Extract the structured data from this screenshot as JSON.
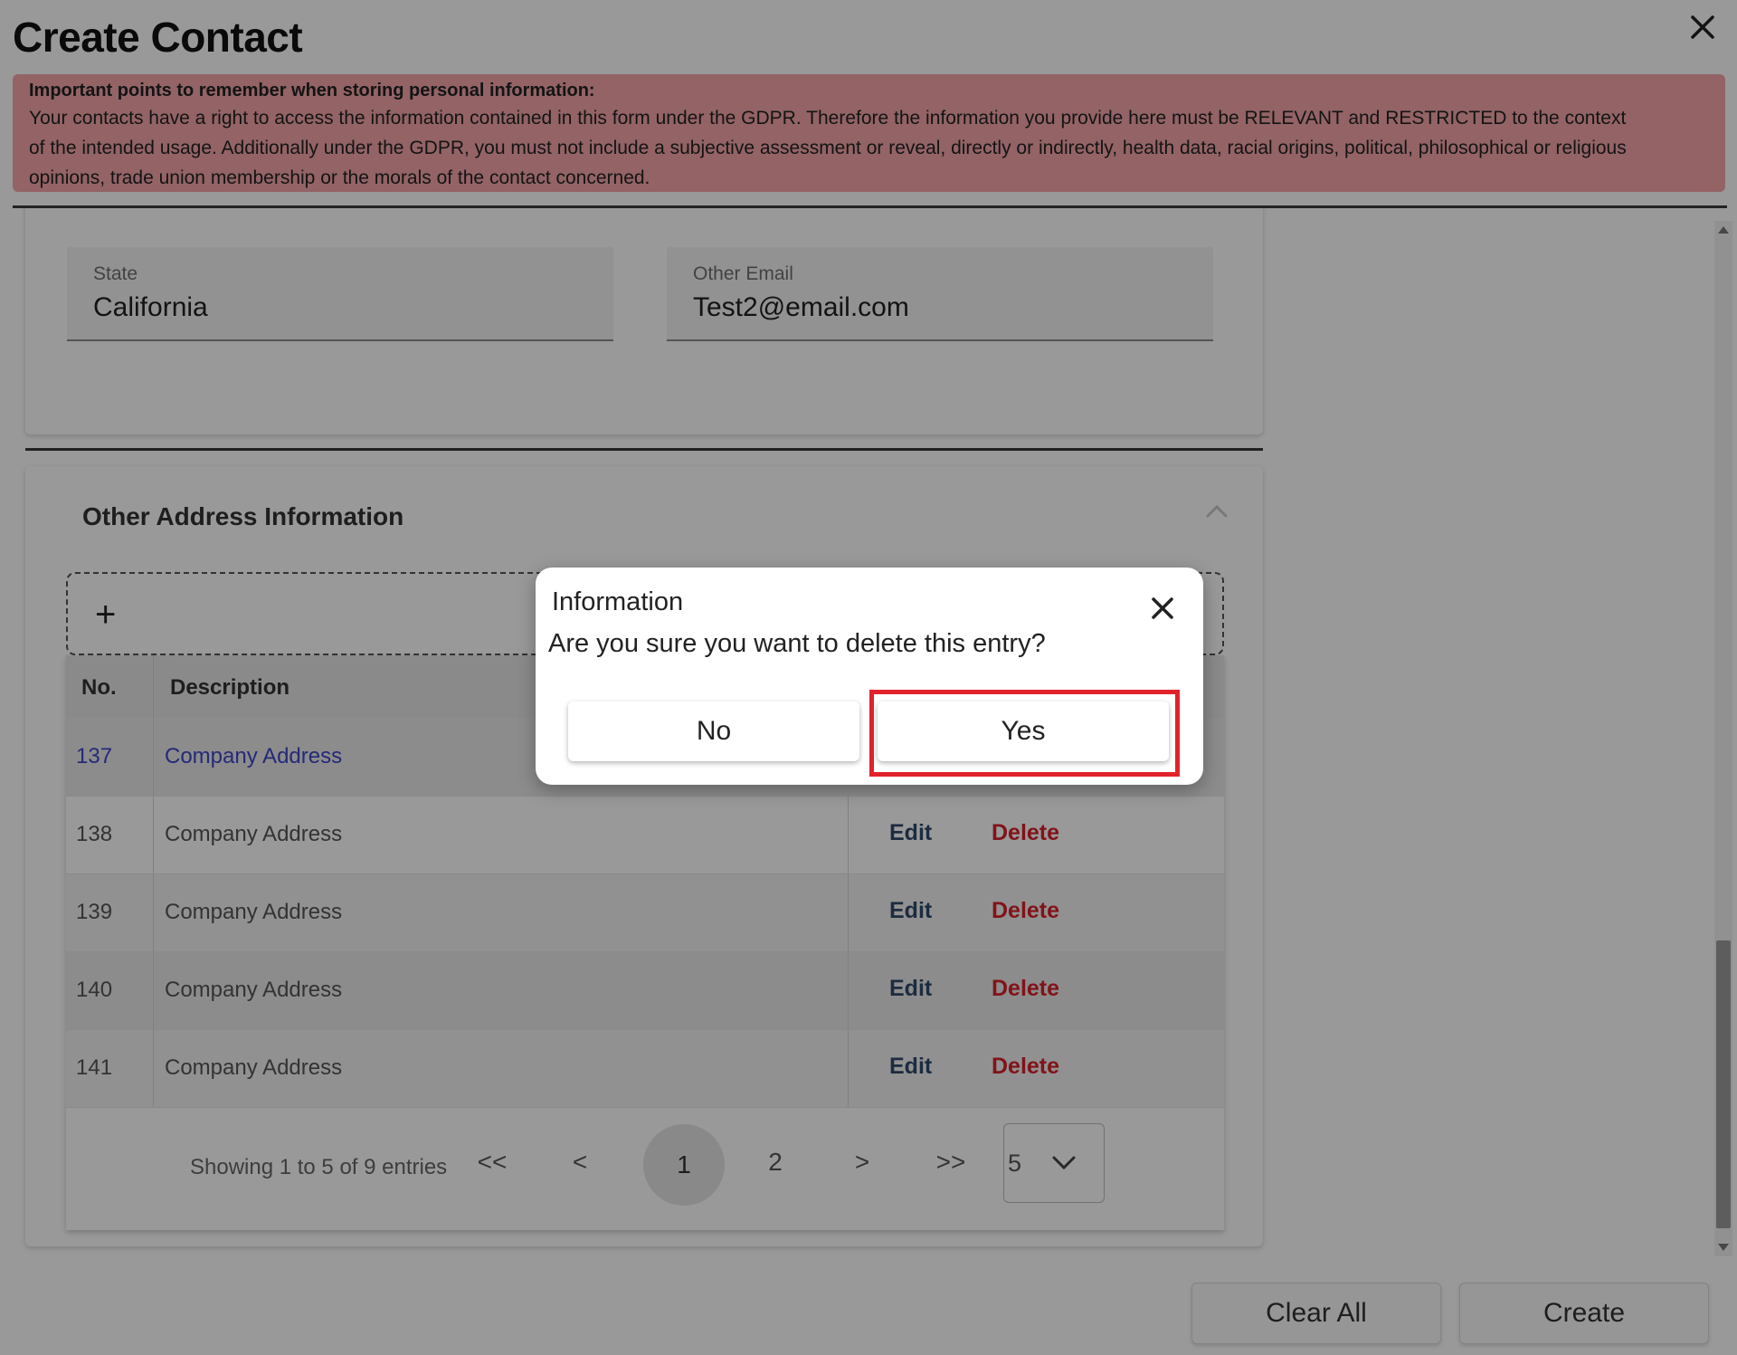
{
  "header": {
    "title": "Create Contact"
  },
  "gdpr_notice": {
    "title": "Important points to remember when storing personal information:",
    "line1": "Your contacts have a right to access the information contained in this form under the GDPR. Therefore the information you provide here must be RELEVANT and RESTRICTED to the context",
    "line2": "of the intended usage. Additionally under the GDPR, you must not include a subjective assessment or reveal, directly or indirectly, health data, racial origins, political, philosophical or religious",
    "line3": "opinions, trade union membership or the morals of the contact concerned."
  },
  "contact_fields": {
    "state": {
      "label": "State",
      "value": "California"
    },
    "other_email": {
      "label": "Other Email",
      "value": "Test2@email.com"
    }
  },
  "other_address": {
    "title": "Other Address Information",
    "add_symbol": "+",
    "columns": {
      "no": "No.",
      "description": "Description"
    },
    "rows": [
      {
        "no": "137",
        "description": "Company Address"
      },
      {
        "no": "138",
        "description": "Company Address",
        "edit": "Edit",
        "delete": "Delete"
      },
      {
        "no": "139",
        "description": "Company Address",
        "edit": "Edit",
        "delete": "Delete"
      },
      {
        "no": "140",
        "description": "Company Address",
        "edit": "Edit",
        "delete": "Delete"
      },
      {
        "no": "141",
        "description": "Company Address",
        "edit": "Edit",
        "delete": "Delete"
      }
    ],
    "pagination": {
      "info": "Showing 1 to 5 of 9 entries",
      "first": "<<",
      "prev": "<",
      "current_page": "1",
      "next_page": "2",
      "next": ">",
      "last": ">>",
      "page_size": "5"
    }
  },
  "footer": {
    "clear_all": "Clear All",
    "create": "Create"
  },
  "dialog": {
    "title": "Information",
    "message": "Are you sure you want to delete this entry?",
    "no_label": "No",
    "yes_label": "Yes"
  },
  "colors": {
    "gdpr_background": "#f5a6aa",
    "delete_red": "#d8212a",
    "edit_blue": "#2f4a6b",
    "link_blue": "#3f46c9",
    "highlight_red": "#e1222b"
  },
  "icons": [
    "close-icon",
    "chevron-up-icon",
    "plus-icon",
    "chevron-down-icon"
  ]
}
